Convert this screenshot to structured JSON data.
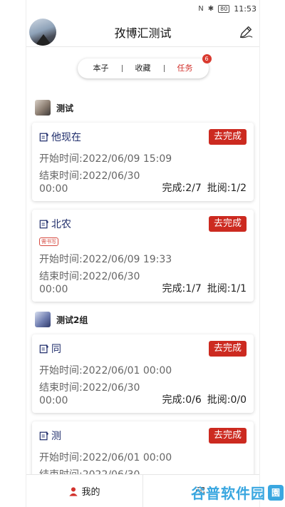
{
  "status_bar": {
    "time": "11:53",
    "battery": "80"
  },
  "header": {
    "title": "孜博汇测试"
  },
  "tabs": [
    {
      "label": "本子",
      "active": false
    },
    {
      "label": "收藏",
      "active": false
    },
    {
      "label": "任务",
      "active": true,
      "badge": "6"
    }
  ],
  "groups": [
    {
      "name": "测试",
      "cards": [
        {
          "title": "他现在",
          "button": "去完成",
          "start": "开始时间:2022/06/09 15:09",
          "end": "结束时间:2022/06/30 00:00",
          "done": "完成:2/7",
          "review": "批阅:1/2"
        },
        {
          "title": "北农",
          "tag": "需书写",
          "button": "去完成",
          "start": "开始时间:2022/06/09 19:33",
          "end": "结束时间:2022/06/30 00:00",
          "done": "完成:1/7",
          "review": "批阅:1/1"
        }
      ]
    },
    {
      "name": "测试2组",
      "cards": [
        {
          "title": "同",
          "button": "去完成",
          "start": "开始时间:2022/06/01 00:00",
          "end": "结束时间:2022/06/30 00:00",
          "done": "完成:0/6",
          "review": "批阅:0/0"
        },
        {
          "title": "测",
          "button": "去完成",
          "start": "开始时间:2022/06/01 00:00",
          "end": "结束时间:2022/06/30",
          "done": "",
          "review": ""
        }
      ]
    }
  ],
  "bottom_nav": {
    "mine": "我的",
    "second": ""
  },
  "watermark": {
    "text": "谷普软件园",
    "badge": "園"
  },
  "colors": {
    "accent": "#cc2a20",
    "title_blue": "#1f2d6b",
    "watermark": "#3aa7e0"
  }
}
